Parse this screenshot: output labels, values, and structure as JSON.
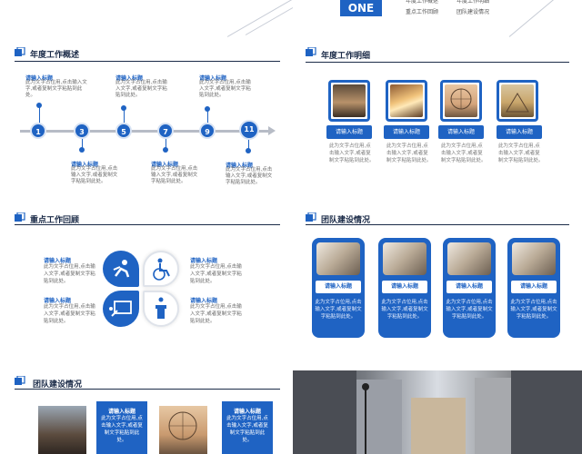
{
  "colors": {
    "accent": "#1f63c3",
    "dark": "#1b2b48",
    "gray": "#b7bcc6"
  },
  "top": {
    "badge": "ONE",
    "line1": "年度工作概述",
    "line2": "重点工作回顾",
    "line3": "年度工作明细",
    "line4": "团队建设情况"
  },
  "sections": {
    "overview": "年度工作概述",
    "detail": "年度工作明细",
    "review": "重点工作回顾",
    "team": "团队建设情况",
    "bottom": "团队建设情况"
  },
  "timeline": {
    "nodes": [
      "1",
      "3",
      "5",
      "7",
      "9",
      "11"
    ],
    "placeholder_title": "请输入标题",
    "placeholder_body": "此为文字占位用,点击输入文字,或者复制文字粘贴到此处。"
  },
  "detail": {
    "button": "请输入标题",
    "desc": "此为文字占位用,点击输入文字,或者复制文字粘贴到此处。",
    "photos": [
      "night-street",
      "paris-bridge",
      "ferris-wheel",
      "louvre-pyramid"
    ]
  },
  "review": {
    "title": "请输入标题",
    "body": "此为文字占位用,点击输入文字,或者复制文字粘贴到此处。",
    "icons": [
      "running-person-icon",
      "wheelchair-icon",
      "presentation-icon",
      "podium-icon"
    ]
  },
  "team": {
    "button": "请输入标题",
    "desc": "此为文字占位用,点击输入文字,或者复制文字粘贴到此处。"
  },
  "bottom": {
    "title": "请输入标题",
    "body": "此为文字占位用,点击输入文字,或者复制文字粘贴到此处。"
  }
}
